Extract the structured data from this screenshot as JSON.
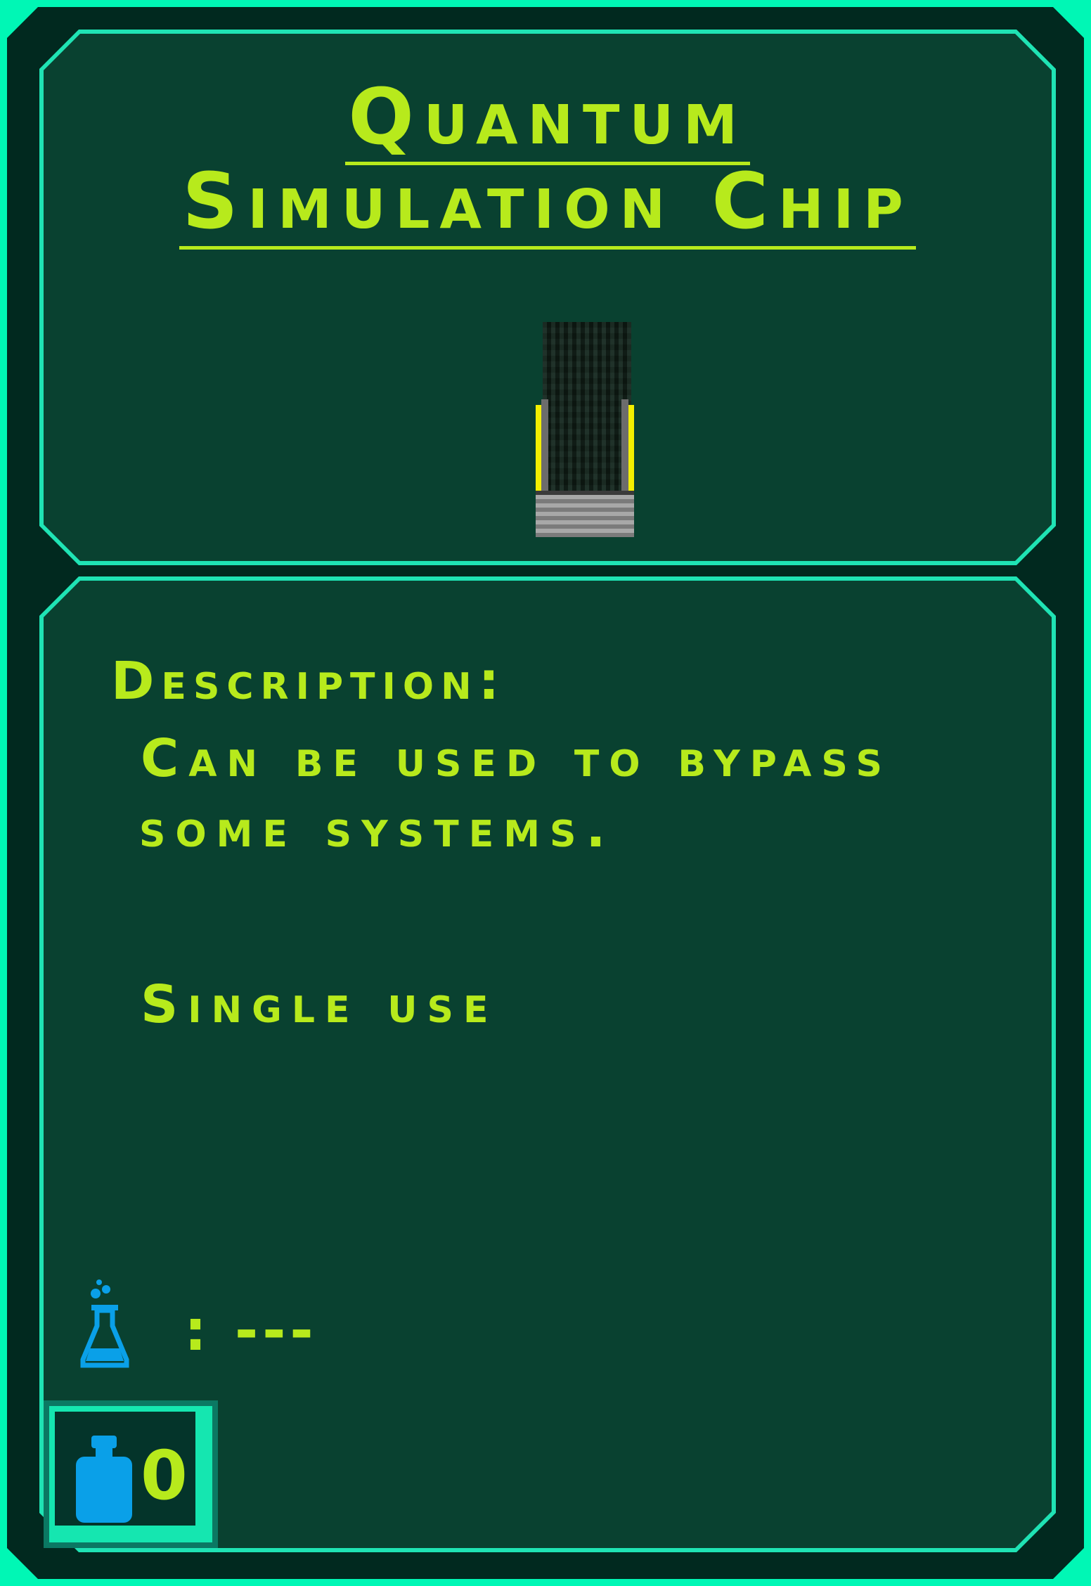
{
  "item": {
    "title_line1": "Quantum",
    "title_line2": "Simulation Chip",
    "icon": "simulation-chip-sprite"
  },
  "description": {
    "heading": "Description:",
    "line1": "Can be used to bypass",
    "line2": "some systems.",
    "extra": "Single use"
  },
  "stats": {
    "research_icon": "flask-icon",
    "research_separator": ":",
    "research_value": "---",
    "weight_icon": "weight-icon",
    "weight_value": "0"
  },
  "colors": {
    "text": "#b7ea1c",
    "border": "#1fe3b4",
    "panel": "#094130",
    "frame": "#01291f",
    "outer": "#00f7b5",
    "icon": "#0aa0e8"
  }
}
